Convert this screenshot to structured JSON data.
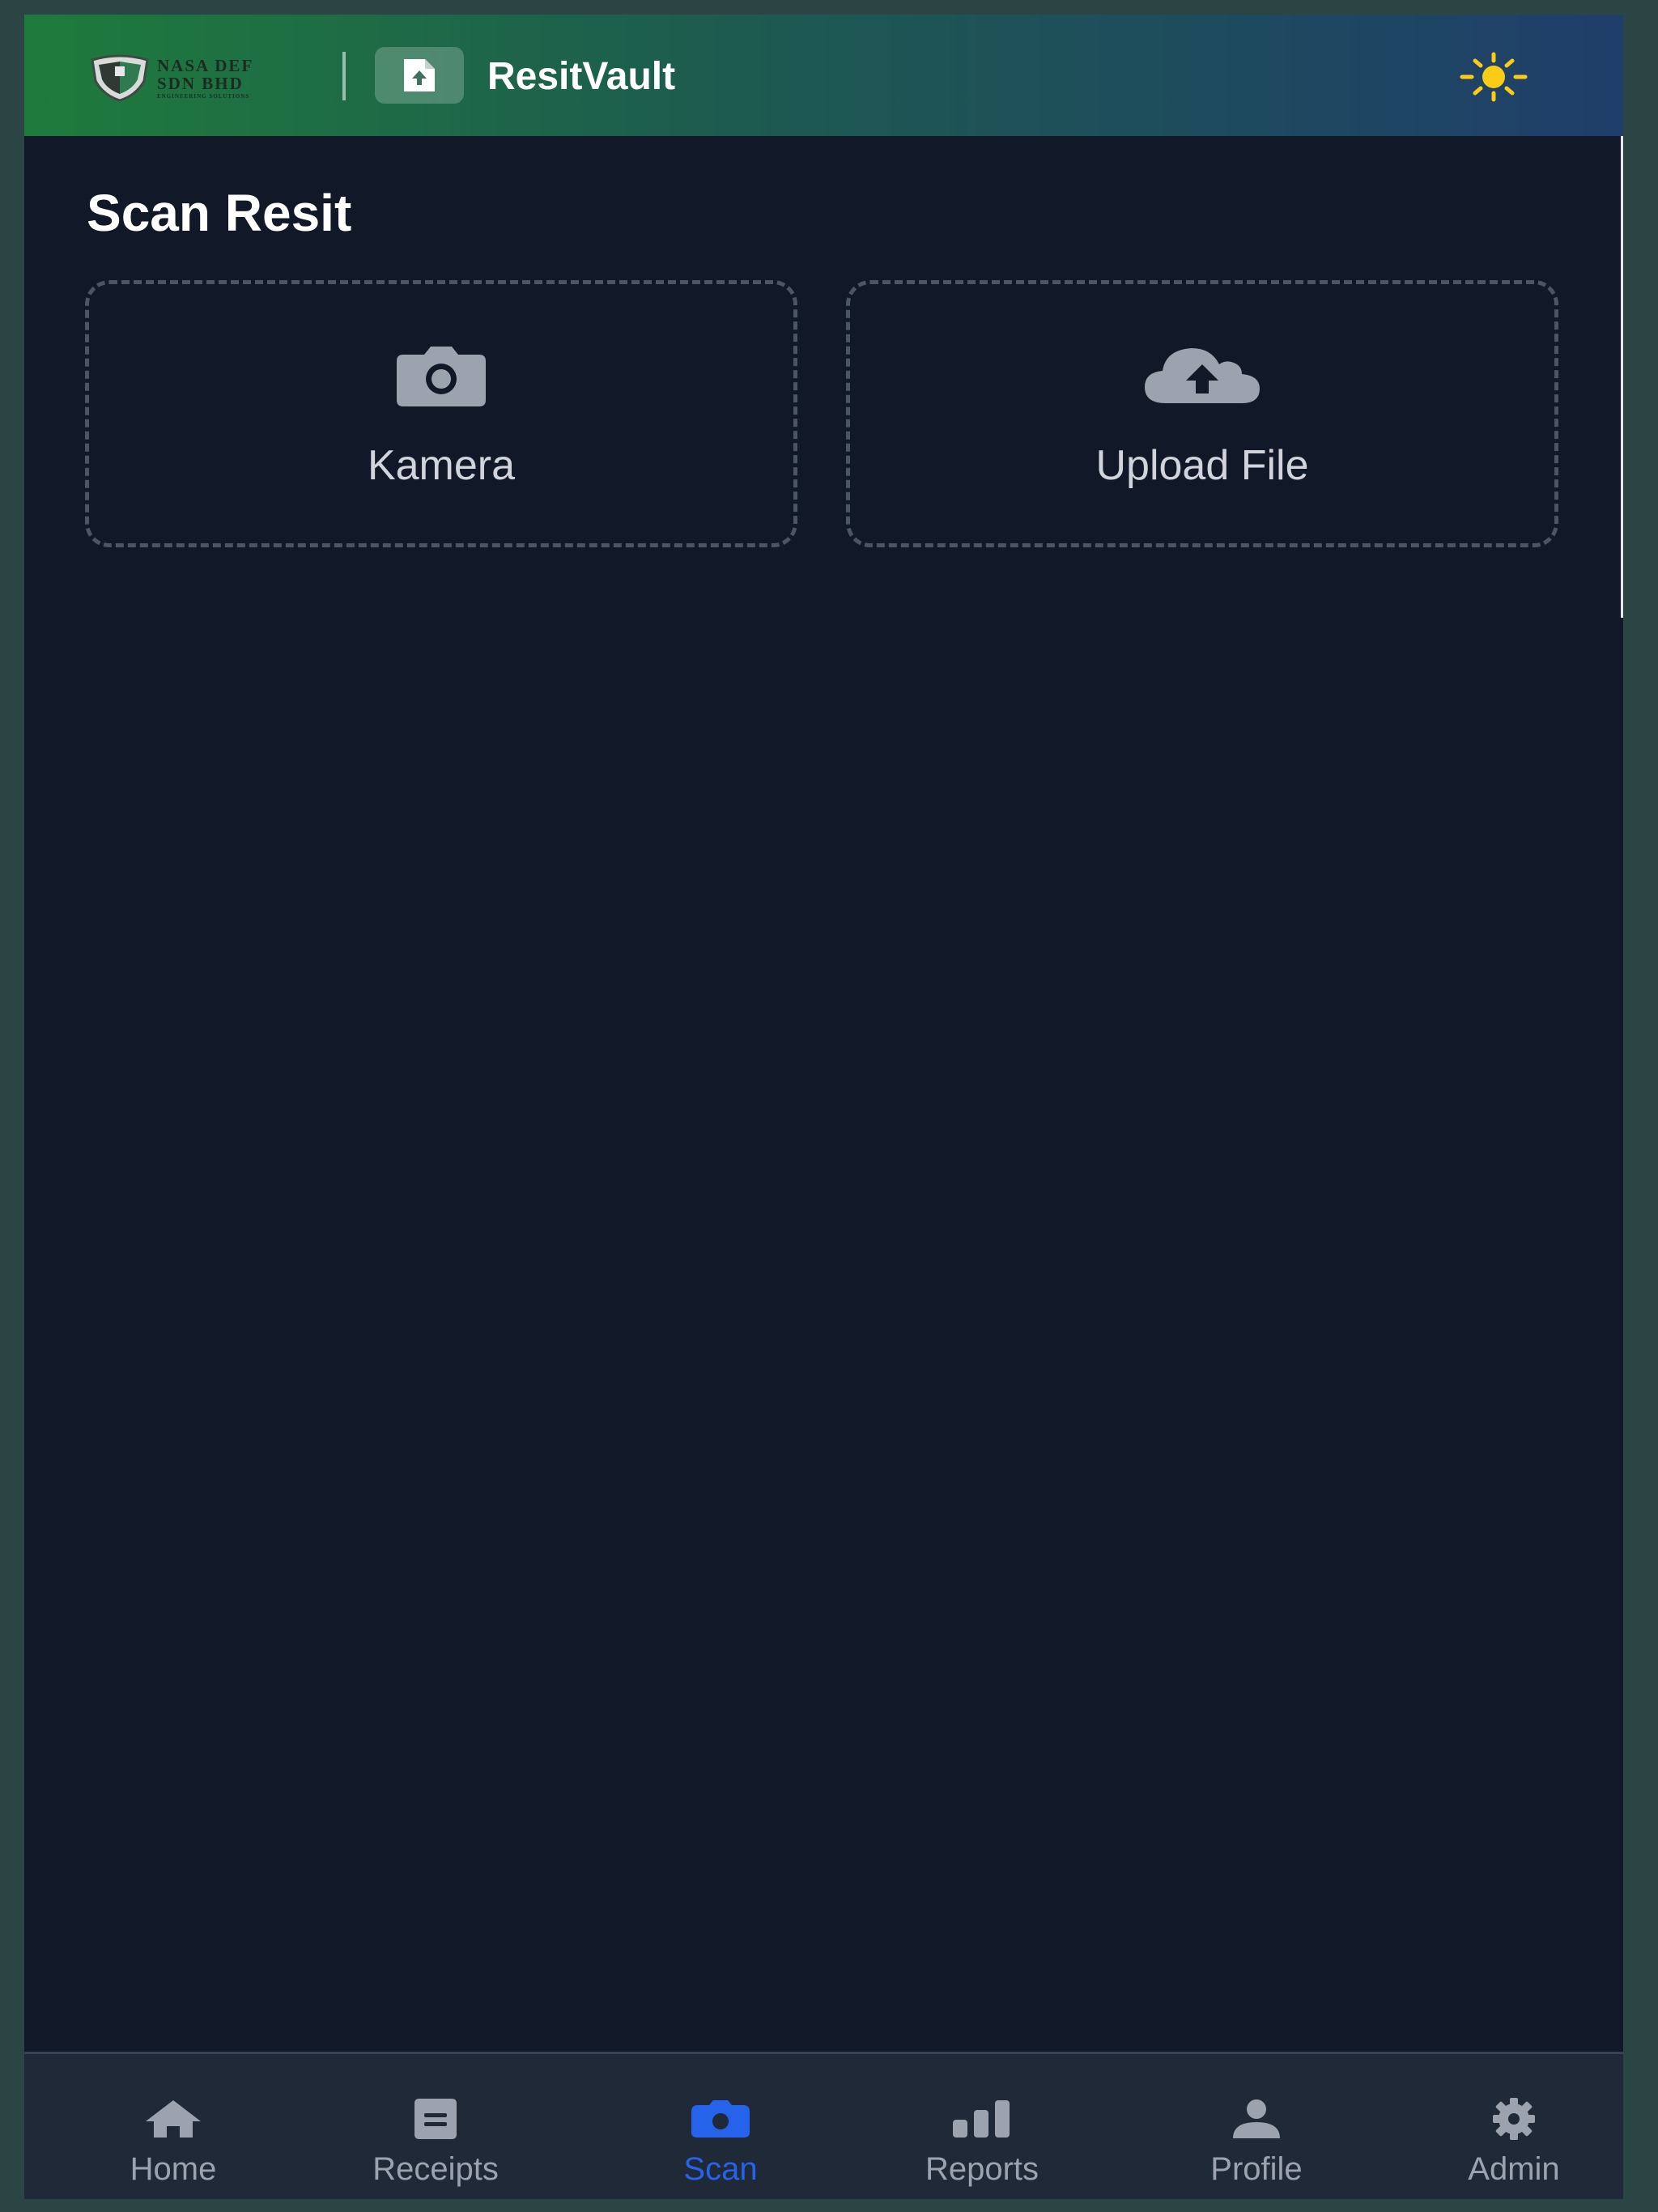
{
  "header": {
    "company_logo": {
      "lines": [
        "NASA DEF",
        "SDN BHD",
        "ENGINEERING SOLUTIONS"
      ],
      "icon": "shield-logo"
    },
    "app_icon": "document-upload-icon",
    "app_title": "ResitVault",
    "theme_toggle_icon": "sun-icon",
    "accent_sun_color": "#facc15"
  },
  "main": {
    "page_title": "Scan Resit",
    "cards": [
      {
        "icon": "camera-icon",
        "label": "Kamera"
      },
      {
        "icon": "cloud-upload-icon",
        "label": "Upload File"
      }
    ]
  },
  "nav": {
    "active_color": "#2563eb",
    "items": [
      {
        "icon": "home-icon",
        "label": "Home"
      },
      {
        "icon": "receipt-icon",
        "label": "Receipts"
      },
      {
        "icon": "camera-icon",
        "label": "Scan",
        "active": true
      },
      {
        "icon": "bar-chart-icon",
        "label": "Reports"
      },
      {
        "icon": "user-icon",
        "label": "Profile"
      },
      {
        "icon": "gear-icon",
        "label": "Admin"
      }
    ]
  }
}
